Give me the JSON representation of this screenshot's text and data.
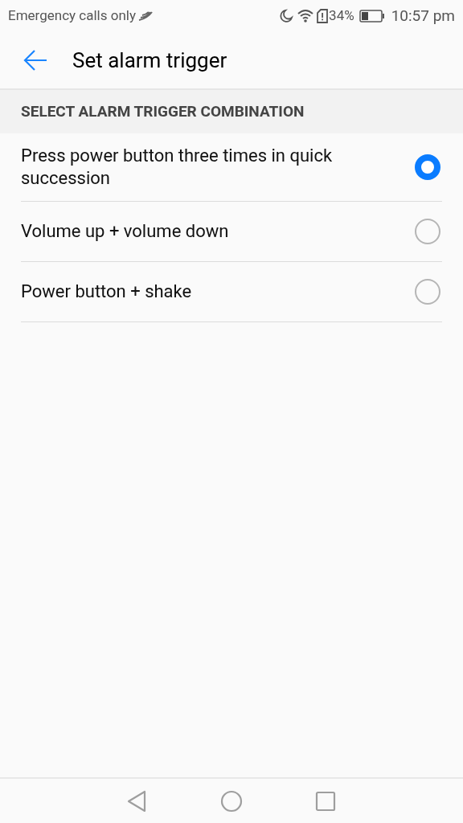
{
  "status_bar": {
    "carrier": "Emergency calls only",
    "battery_percent": "34%",
    "time": "10:57 pm"
  },
  "app_bar": {
    "title": "Set alarm trigger"
  },
  "section": {
    "header": "SELECT ALARM TRIGGER COMBINATION"
  },
  "options": [
    {
      "label": "Press power button three times in quick succession",
      "selected": true
    },
    {
      "label": "Volume up + volume down",
      "selected": false
    },
    {
      "label": "Power button + shake",
      "selected": false
    }
  ]
}
